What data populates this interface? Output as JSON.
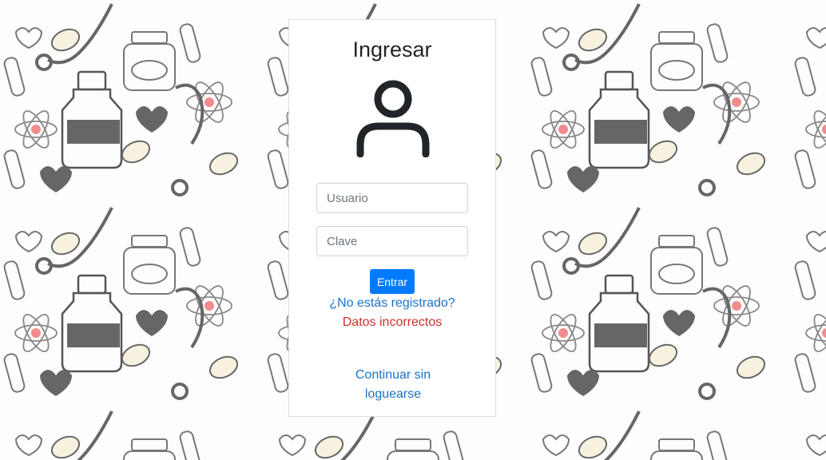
{
  "login": {
    "title": "Ingresar",
    "username_placeholder": "Usuario",
    "password_placeholder": "Clave",
    "submit_label": "Entrar",
    "register_link": "¿No estás registrado?",
    "error_message": "Datos incorrectos",
    "guest_link": "Continuar sin loguearse"
  },
  "colors": {
    "primary": "#007bff",
    "link": "#1a73c9",
    "error": "#c9302c",
    "title": "#212529"
  },
  "icons": {
    "avatar": "user-icon",
    "background": "medical-doodle-pattern"
  }
}
